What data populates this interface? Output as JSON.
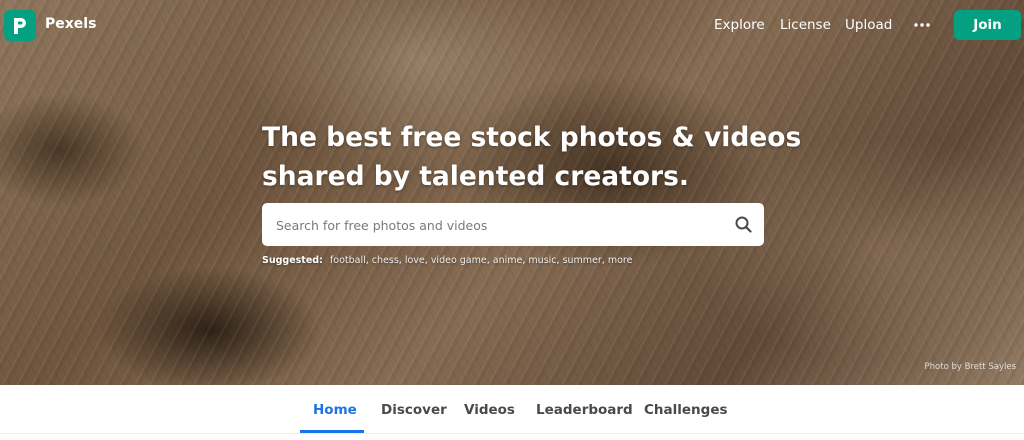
{
  "brand": {
    "name": "Pexels",
    "color": "#05a081"
  },
  "nav": {
    "links": [
      "Explore",
      "License",
      "Upload"
    ],
    "more_icon": "ellipsis-icon",
    "join_label": "Join"
  },
  "hero": {
    "headline_line1": "The best free stock photos & videos",
    "headline_line2": "shared by talented creators.",
    "search_placeholder": "Search for free photos and videos",
    "search_icon": "search-icon",
    "suggested_label": "Suggested:",
    "suggestions": [
      "football",
      "chess",
      "love",
      "video game",
      "anime",
      "music",
      "summer",
      "more"
    ],
    "credit": "Photo by Brett Sayles"
  },
  "tabs": {
    "items": [
      "Home",
      "Discover",
      "Videos",
      "Leaderboard",
      "Challenges"
    ],
    "active": "Home",
    "active_color": "#1a73e8"
  }
}
